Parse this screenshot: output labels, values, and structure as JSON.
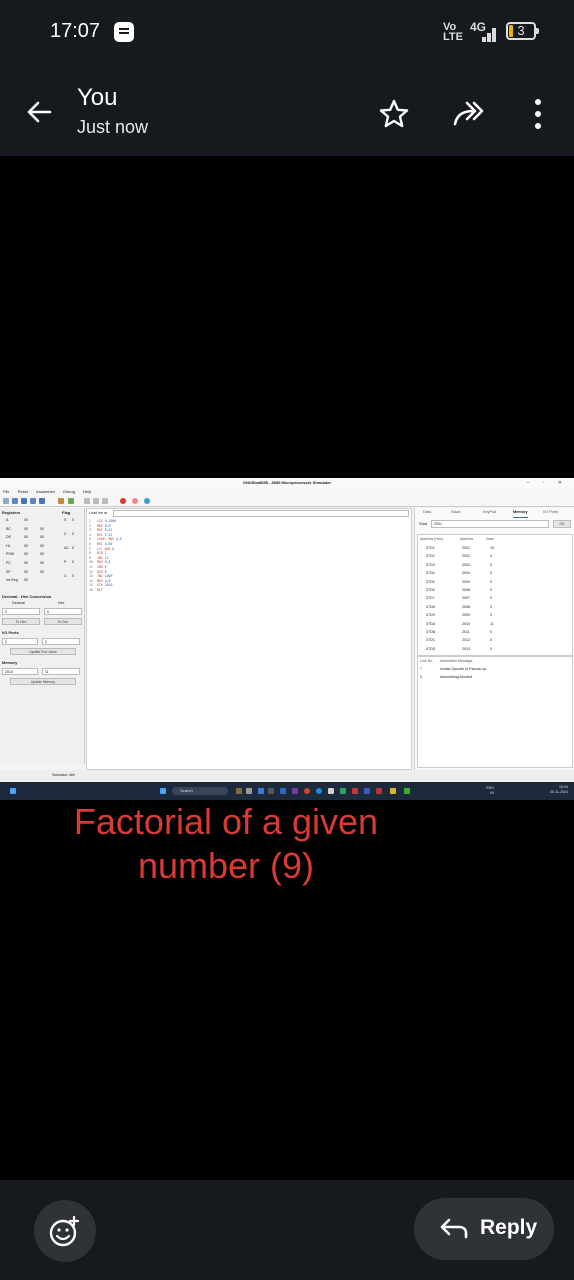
{
  "status_bar": {
    "time": "17:07",
    "volte_top": "Vo",
    "volte_bottom": "LTE",
    "network": "4G",
    "battery": "3"
  },
  "header": {
    "sender": "You",
    "timestamp": "Just now",
    "icons": [
      "back-arrow-icon",
      "star-icon",
      "forward-icon",
      "more-vert-icon"
    ]
  },
  "simulator": {
    "window_title": "GNUSim8085 - 8085 Microprocessor Simulator",
    "menu": [
      "File",
      "Reset",
      "Assembler",
      "Debug",
      "Help"
    ],
    "registers_label": "Registers",
    "flag_label": "Flag",
    "registers": [
      {
        "name": "A",
        "v1": "00",
        "v2": ""
      },
      {
        "name": "BC",
        "v1": "00",
        "v2": "00"
      },
      {
        "name": "DE",
        "v1": "00",
        "v2": "00"
      },
      {
        "name": "HL",
        "v1": "00",
        "v2": "00"
      },
      {
        "name": "PSW",
        "v1": "00",
        "v2": "00"
      },
      {
        "name": "PC",
        "v1": "00",
        "v2": "00"
      },
      {
        "name": "SP",
        "v1": "00",
        "v2": "00"
      },
      {
        "name": "Int-Reg",
        "v1": "00",
        "v2": ""
      }
    ],
    "flags": [
      {
        "name": "S",
        "value": "0"
      },
      {
        "name": "Z",
        "value": "0"
      },
      {
        "name": "AC",
        "value": "0"
      },
      {
        "name": "P",
        "value": "0"
      },
      {
        "name": "C",
        "value": "0"
      }
    ],
    "conversion": {
      "heading": "Decimal - Hex Conversion",
      "decimal_label": "Decimal",
      "hex_label": "Hex",
      "decimal_value": "0",
      "hex_value": "0",
      "to_hex_btn": "To Hex",
      "to_dec_btn": "To Dec"
    },
    "io_ports": {
      "heading": "I/O Ports",
      "port": "0",
      "value": "0",
      "update_btn": "Update Port Value"
    },
    "memory": {
      "heading": "Memory",
      "address": "2010",
      "value": "11",
      "update_btn": "Update Memory"
    },
    "editor_label": "Load me at",
    "code": [
      {
        "n": "1",
        "m": "LXI",
        "o": "H,2000"
      },
      {
        "n": "2",
        "m": "MOV",
        "o": "B,M"
      },
      {
        "n": "3",
        "m": "MVI",
        "o": "D,01"
      },
      {
        "n": "4",
        "m": "MVI",
        "o": "E,01"
      },
      {
        "n": "5",
        "m": "LOOP: MOV",
        "o": "A,E"
      },
      {
        "n": "6",
        "m": "MVI",
        "o": "A,00"
      },
      {
        "n": "7",
        "m": "L2: ADD",
        "o": "D"
      },
      {
        "n": "8",
        "m": "DCR",
        "o": "C"
      },
      {
        "n": "9",
        "m": "JNZ",
        "o": "L2"
      },
      {
        "n": "10",
        "m": "MOV",
        "o": "D,A"
      },
      {
        "n": "11",
        "m": "INR",
        "o": "E"
      },
      {
        "n": "12",
        "m": "DCR",
        "o": "B"
      },
      {
        "n": "13",
        "m": "JNZ",
        "o": "LOOP"
      },
      {
        "n": "14",
        "m": "MOV",
        "o": "A,D"
      },
      {
        "n": "15",
        "m": "STA",
        "o": "2010"
      },
      {
        "n": "16",
        "m": "HLT",
        "o": ""
      }
    ],
    "tabs": [
      "Data",
      "Stack",
      "KeyPad",
      "Memory",
      "I/O Ports"
    ],
    "active_tab": "Memory",
    "start_label": "Start",
    "start_value": "2001",
    "ok_btn": "OK",
    "mem_header": [
      "Address (Hex)",
      "Address",
      "Data"
    ],
    "mem_rows": [
      [
        "07D1",
        "2001",
        "10"
      ],
      [
        "07D2",
        "2002",
        "0"
      ],
      [
        "07D3",
        "2003",
        "0"
      ],
      [
        "07D4",
        "2004",
        "0"
      ],
      [
        "07D5",
        "2005",
        "0"
      ],
      [
        "07D6",
        "2006",
        "0"
      ],
      [
        "07D7",
        "2007",
        "0"
      ],
      [
        "07D8",
        "2008",
        "0"
      ],
      [
        "07D9",
        "2009",
        "0"
      ],
      [
        "07DA",
        "2010",
        "11"
      ],
      [
        "07DB",
        "2011",
        "0"
      ],
      [
        "07DC",
        "2012",
        "0"
      ],
      [
        "07DD",
        "2013",
        "0"
      ]
    ],
    "msg_header": [
      "Line No",
      "Assembler Message"
    ],
    "messages": [
      [
        "7",
        "Invalid Opcode or Pseudo op"
      ],
      [
        "0",
        "Assembling Aborted"
      ]
    ],
    "status": "Simulator: Idle",
    "taskbar_search": "Search",
    "tray_lang": "ENG",
    "tray_region": "IN",
    "tray_time": "15:04",
    "tray_date": "30-11-2024"
  },
  "caption": {
    "line1": "Factorial of a given",
    "line2": "number (9)",
    "color": "#d93a35"
  },
  "bottom": {
    "reply_label": "Reply"
  }
}
